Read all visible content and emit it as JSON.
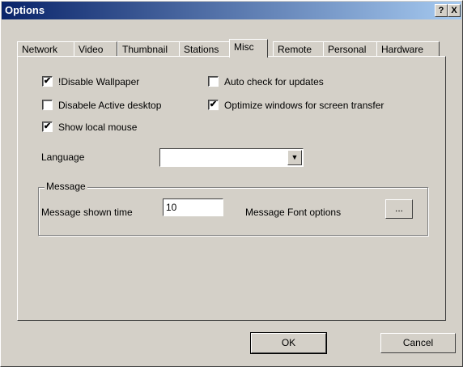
{
  "window": {
    "title": "Options"
  },
  "titlebar": {
    "help_label": "?",
    "close_label": "X"
  },
  "tabs": [
    {
      "label": "Network"
    },
    {
      "label": "Video"
    },
    {
      "label": "Thumbnail"
    },
    {
      "label": "Stations"
    },
    {
      "label": "Misc"
    },
    {
      "label": "Remote"
    },
    {
      "label": "Personal"
    },
    {
      "label": "Hardware"
    }
  ],
  "misc": {
    "disable_wallpaper": {
      "label": "!Disable Wallpaper",
      "checked": true
    },
    "disable_active_desktop": {
      "label": "Disabele Active desktop",
      "checked": false
    },
    "show_local_mouse": {
      "label": "Show local mouse",
      "checked": true
    },
    "auto_check_updates": {
      "label": "Auto check for updates",
      "checked": false
    },
    "optimize_windows": {
      "label": "Optimize windows for screen transfer",
      "checked": true
    },
    "language_label": "Language",
    "language_value": "",
    "message_group_title": "Message",
    "message_time_label": "Message shown time",
    "message_time_value": "10",
    "message_font_label": "Message Font options",
    "message_font_button": "..."
  },
  "buttons": {
    "ok": "OK",
    "cancel": "Cancel"
  }
}
